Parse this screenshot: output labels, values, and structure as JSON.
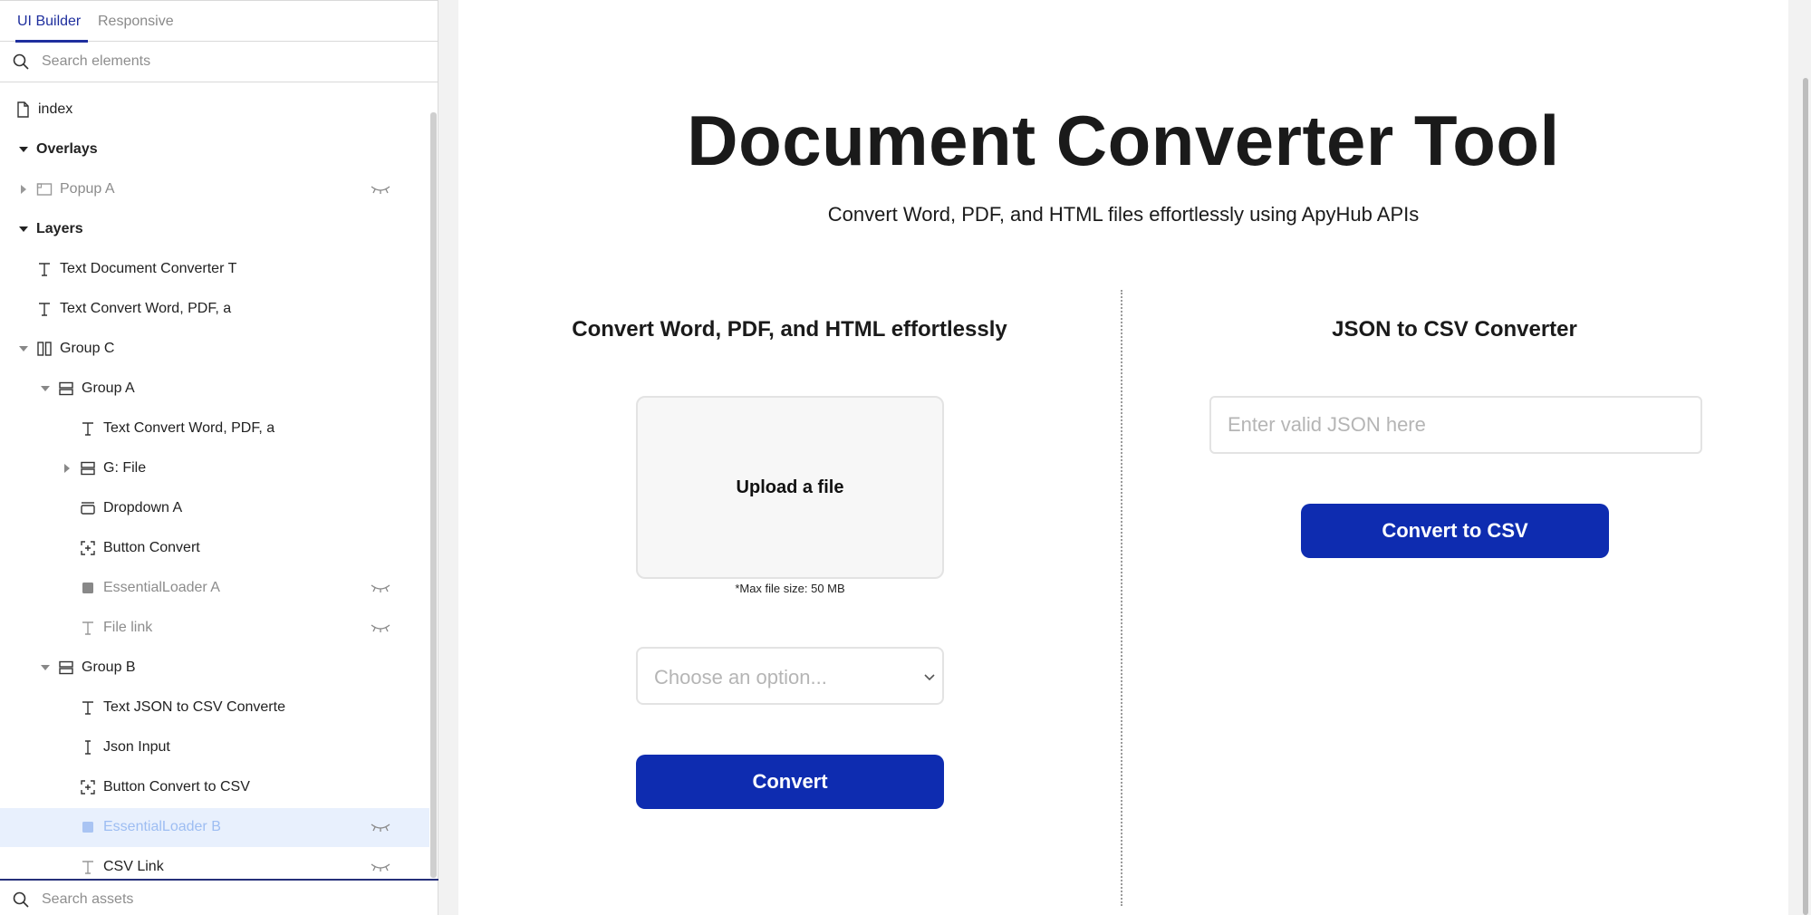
{
  "sidebar": {
    "tabs": [
      {
        "label": "UI Builder",
        "active": true
      },
      {
        "label": "Responsive",
        "active": false
      }
    ],
    "search_placeholder": "Search elements",
    "assets_placeholder": "Search assets",
    "tree": [
      {
        "label": "index",
        "icon": "page-icon"
      },
      {
        "label": "Overlays",
        "icon": "none"
      },
      {
        "label": "Popup A",
        "icon": "popup-icon",
        "hidden": true
      },
      {
        "label": "Layers",
        "icon": "none"
      },
      {
        "label": "Text Document Converter T",
        "icon": "text-icon"
      },
      {
        "label": "Text Convert Word, PDF, a",
        "icon": "text-icon"
      },
      {
        "label": "Group C",
        "icon": "column-group-icon"
      },
      {
        "label": "Group A",
        "icon": "row-group-icon"
      },
      {
        "label": "Text Convert Word, PDF, a",
        "icon": "text-icon"
      },
      {
        "label": "G: File",
        "icon": "row-group-icon"
      },
      {
        "label": "Dropdown A",
        "icon": "dropdown-icon"
      },
      {
        "label": "Button Convert",
        "icon": "button-icon"
      },
      {
        "label": "EssentialLoader A",
        "icon": "square-icon",
        "hidden": true
      },
      {
        "label": "File link",
        "icon": "text-icon",
        "hidden": true
      },
      {
        "label": "Group B",
        "icon": "row-group-icon"
      },
      {
        "label": "Text JSON to CSV Converte",
        "icon": "text-icon"
      },
      {
        "label": "Json Input",
        "icon": "input-icon"
      },
      {
        "label": "Button Convert to CSV",
        "icon": "button-icon"
      },
      {
        "label": "EssentialLoader B",
        "icon": "square-icon",
        "hidden": true,
        "selected": true
      },
      {
        "label": "CSV Link",
        "icon": "text-icon",
        "hidden": true
      }
    ]
  },
  "page": {
    "title": "Document Converter Tool",
    "subtitle": "Convert Word, PDF, and HTML files effortlessly using ApyHub APIs",
    "left": {
      "heading": "Convert Word, PDF, and HTML effortlessly",
      "upload_label": "Upload a file",
      "max_size": "*Max file size: 50 MB",
      "select_placeholder": "Choose an option...",
      "button": "Convert"
    },
    "right": {
      "heading": "JSON to CSV Converter",
      "input_placeholder": "Enter valid JSON here",
      "button": "Convert to CSV"
    }
  },
  "colors": {
    "accent": "#0e2cb0",
    "tab_active": "#1f2f9e",
    "selected_row": "#e8f0fd"
  }
}
